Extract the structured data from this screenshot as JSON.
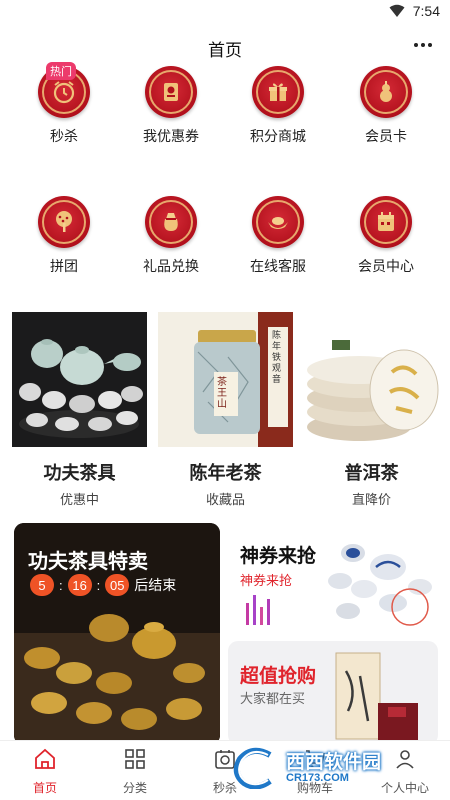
{
  "status": {
    "time": "7:54"
  },
  "header": {
    "title": "首页"
  },
  "grid_row1": [
    {
      "label": "秒杀",
      "icon": "alarm-clock-icon",
      "badge": "热门"
    },
    {
      "label": "我优惠券",
      "icon": "coupon-icon"
    },
    {
      "label": "积分商城",
      "icon": "gift-box-icon"
    },
    {
      "label": "会员卡",
      "icon": "gourd-icon"
    }
  ],
  "grid_row2": [
    {
      "label": "拼团",
      "icon": "tree-icon"
    },
    {
      "label": "礼品兑换",
      "icon": "fortune-bag-icon"
    },
    {
      "label": "在线客服",
      "icon": "gold-ingot-icon"
    },
    {
      "label": "会员中心",
      "icon": "calendar-icon"
    }
  ],
  "products": [
    {
      "name": "功夫茶具",
      "sub": "优惠中"
    },
    {
      "name": "陈年老茶",
      "sub": "收藏品",
      "img_text": "茶王山",
      "img_text2": "陈年铁观音"
    },
    {
      "name": "普洱茶",
      "sub": "直降价"
    }
  ],
  "promo_big": {
    "title": "功夫茶具特卖",
    "hours": "5",
    "minutes": "16",
    "seconds": "05",
    "end_text": "后结束"
  },
  "promo_top_right": {
    "title": "神券来抢",
    "sub": "神券来抢"
  },
  "promo_bottom_right": {
    "title": "超值抢购",
    "sub": "大家都在买"
  },
  "tabs": [
    {
      "label": "首页",
      "icon": "home-icon",
      "active": true
    },
    {
      "label": "分类",
      "icon": "grid-icon"
    },
    {
      "label": "秒杀",
      "icon": "timer-icon"
    },
    {
      "label": "购物车",
      "icon": "cart-icon"
    },
    {
      "label": "个人中心",
      "icon": "user-icon"
    }
  ],
  "watermark": {
    "brand": "西西软件园",
    "url": "CR173.COM"
  },
  "colors": {
    "accent": "#e0242c",
    "icon_red": "#b1101c",
    "gold": "#f0c27a",
    "countdown": "#ef5326"
  }
}
